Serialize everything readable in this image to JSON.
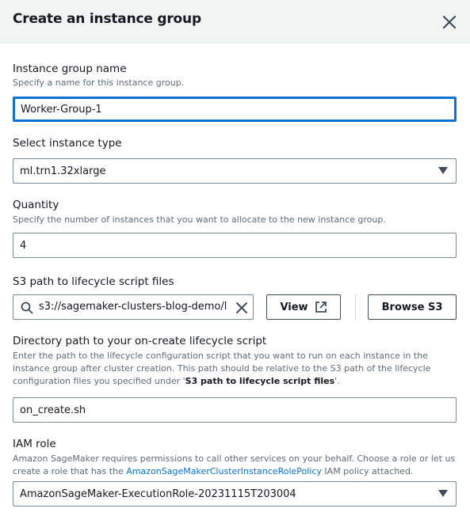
{
  "dialog": {
    "title": "Create an instance group"
  },
  "group_name": {
    "label": "Instance group name",
    "description": "Specify a name for this instance group.",
    "value": "Worker-Group-1"
  },
  "instance_type": {
    "label": "Select instance type",
    "value": "ml.trn1.32xlarge"
  },
  "quantity": {
    "label": "Quantity",
    "description": "Specify the number of instances that you want to allocate to the new instance group.",
    "value": "4"
  },
  "s3_path": {
    "label": "S3 path to lifecycle script files",
    "value": "s3://sagemaker-clusters-blog-demo/l",
    "view_label": "View",
    "browse_label": "Browse S3"
  },
  "on_create": {
    "label": "Directory path to your on-create lifecycle script",
    "description_line1": "Enter the path to the lifecycle configuration script that you want to run on each instance in the",
    "description_line2": "instance group after cluster creation. This path should be relative to the S3 path of the lifecycle",
    "description_line3_pre": "configuration files you specified under '",
    "description_line3_bold": "S3 path to lifecycle script files",
    "description_line3_post": "'.",
    "value": "on_create.sh"
  },
  "iam_role": {
    "label": "IAM role",
    "description_line1": "Amazon SageMaker requires permissions to call other services on your behalf. Choose a role or let us",
    "description_line2_pre": "create a role that has the ",
    "description_line2_link": "AmazonSageMakerClusterInstanceRolePolicy",
    "description_line2_post": " IAM policy attached.",
    "value": "AmazonSageMaker-ExecutionRole-20231115T203004"
  },
  "colors": {
    "focus": "#0972d3",
    "link": "#0972d3",
    "header_bg": "#f2f3f3"
  }
}
